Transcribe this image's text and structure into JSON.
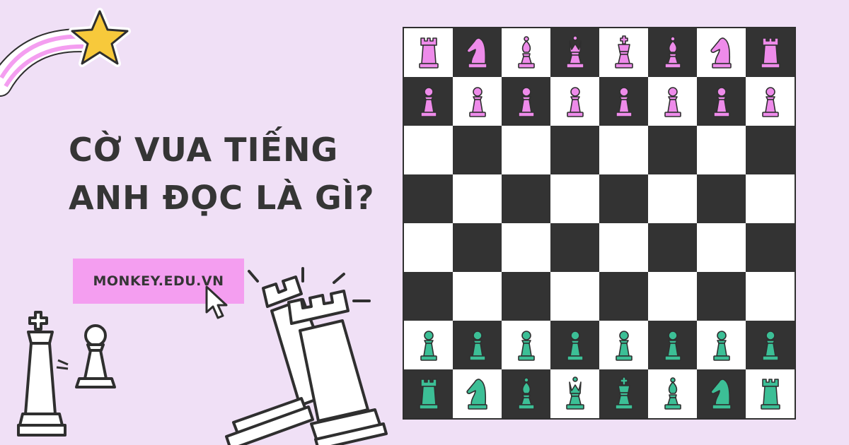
{
  "title": {
    "line1": "CỜ VUA TIẾNG",
    "line2": "ANH ĐỌC LÀ GÌ?"
  },
  "site_button": {
    "label": "MONKEY.EDU.VN"
  },
  "colors": {
    "background": "#f0e0f6",
    "accent_pink": "#f49ef0",
    "pink_piece": "#ee8bea",
    "teal_piece": "#3cbf96",
    "dark_square": "#333333",
    "light_square": "#ffffff",
    "star": "#f7c93b"
  },
  "board": {
    "rows": [
      [
        "pink-rook-icon",
        "pink-knight-icon",
        "pink-bishop-icon",
        "pink-queen-icon",
        "pink-king-icon",
        "pink-bishop-icon",
        "pink-knight-icon",
        "pink-rook-icon"
      ],
      [
        "pink-pawn-icon",
        "pink-pawn-icon",
        "pink-pawn-icon",
        "pink-pawn-icon",
        "pink-pawn-icon",
        "pink-pawn-icon",
        "pink-pawn-icon",
        "pink-pawn-icon"
      ],
      [
        "",
        "",
        "",
        "",
        "",
        "",
        "",
        ""
      ],
      [
        "",
        "",
        "",
        "",
        "",
        "",
        "",
        ""
      ],
      [
        "",
        "",
        "",
        "",
        "",
        "",
        "",
        ""
      ],
      [
        "",
        "",
        "",
        "",
        "",
        "",
        "",
        ""
      ],
      [
        "teal-pawn-icon",
        "teal-pawn-icon",
        "teal-pawn-icon",
        "teal-pawn-icon",
        "teal-pawn-icon",
        "teal-pawn-icon",
        "teal-pawn-icon",
        "teal-pawn-icon"
      ],
      [
        "teal-rook-icon",
        "teal-knight-icon",
        "teal-bishop-icon",
        "teal-queen-icon",
        "teal-king-icon",
        "teal-bishop-icon",
        "teal-knight-icon",
        "teal-rook-icon"
      ]
    ]
  },
  "decorations": [
    "shooting-star-icon",
    "king-pawn-sketch-icon",
    "two-rooks-sketch-icon",
    "pointer-cursor-icon"
  ]
}
